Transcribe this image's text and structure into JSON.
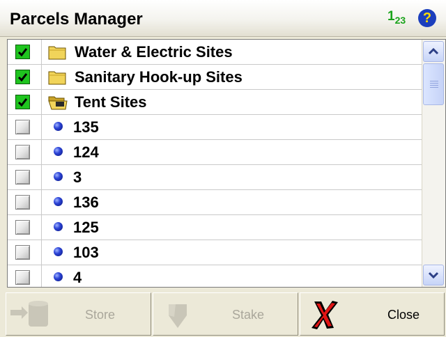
{
  "window": {
    "title": "Parcels Manager"
  },
  "header_icons": {
    "sort": {
      "icon": "sort-123-icon",
      "main": "1",
      "sub": "23"
    },
    "help": {
      "icon": "help-icon",
      "glyph": "?"
    }
  },
  "list": {
    "rows": [
      {
        "type": "folder",
        "label": "Water & Electric Sites",
        "checked": true
      },
      {
        "type": "folder",
        "label": "Sanitary Hook-up Sites",
        "checked": true
      },
      {
        "type": "folder-open",
        "label": "Tent Sites",
        "checked": true
      },
      {
        "type": "site",
        "label": "135",
        "checked": false
      },
      {
        "type": "site",
        "label": "124",
        "checked": false
      },
      {
        "type": "site",
        "label": "3",
        "checked": false
      },
      {
        "type": "site",
        "label": "136",
        "checked": false
      },
      {
        "type": "site",
        "label": "125",
        "checked": false
      },
      {
        "type": "site",
        "label": "103",
        "checked": false
      },
      {
        "type": "site",
        "label": "4",
        "checked": false
      }
    ]
  },
  "buttons": {
    "store": {
      "label": "Store",
      "enabled": false
    },
    "stake": {
      "label": "Stake",
      "enabled": false
    },
    "close": {
      "label": "Close",
      "enabled": true
    }
  }
}
